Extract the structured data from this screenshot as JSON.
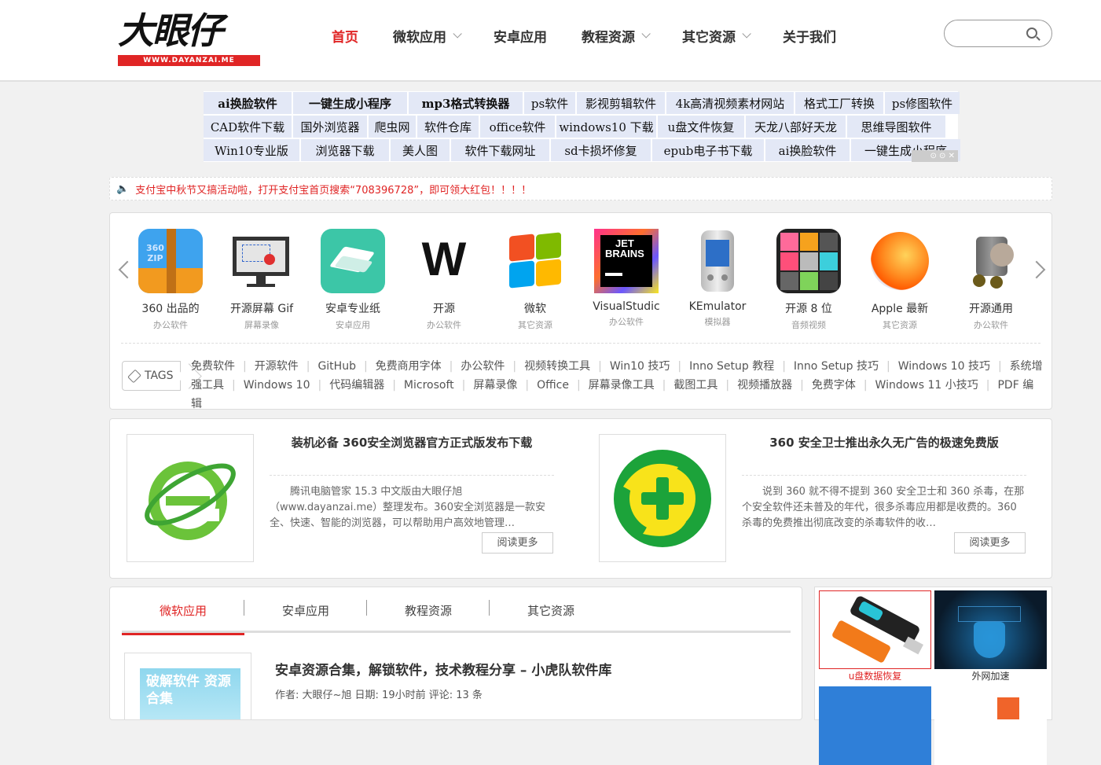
{
  "header": {
    "logo_text": "大眼仔",
    "logo_url": "WWW.DAYANZAI.ME",
    "nav": [
      {
        "label": "首页",
        "active": true,
        "dropdown": false
      },
      {
        "label": "微软应用",
        "active": false,
        "dropdown": true
      },
      {
        "label": "安卓应用",
        "active": false,
        "dropdown": false
      },
      {
        "label": "教程资源",
        "active": false,
        "dropdown": true
      },
      {
        "label": "其它资源",
        "active": false,
        "dropdown": true
      },
      {
        "label": "关于我们",
        "active": false,
        "dropdown": false
      }
    ],
    "search_placeholder": ""
  },
  "ad_links": {
    "row1": [
      "ai换脸软件",
      "一键生成小程序",
      "mp3格式转换器",
      "ps软件",
      "影视剪辑软件",
      "4k高清视频素材网站",
      "格式工厂转换",
      "ps修图软件"
    ],
    "row2": [
      "CAD软件下载",
      "国外浏览器",
      "爬虫网",
      "软件仓库",
      "office软件",
      "windows10 下载",
      "u盘文件恢复",
      "天龙八部好天龙",
      "思维导图软件"
    ],
    "row3": [
      "Win10专业版",
      "浏览器下载",
      "美人图",
      "软件下载网址",
      "sd卡损坏修复",
      "epub电子书下载",
      "ai换脸软件",
      "一键生成小程序"
    ],
    "close_label": "⊙ ⊙ ✕"
  },
  "notice": {
    "text": "支付宝中秋节又搞活动啦，打开支付宝首页搜索“708396728”，即可领大红包！！！！"
  },
  "carousel": {
    "apps": [
      {
        "title": "360 出品的",
        "category": "办公软件",
        "icon": "360zip-icon"
      },
      {
        "title": "开源屏幕 Gif",
        "category": "屏幕录像",
        "icon": "screen-gif-icon"
      },
      {
        "title": "安卓专业纸",
        "category": "安卓应用",
        "icon": "paper-icon"
      },
      {
        "title": "开源",
        "category": "办公软件",
        "icon": "w-letter-icon"
      },
      {
        "title": "微软",
        "category": "其它资源",
        "icon": "windows-icon"
      },
      {
        "title": "VisualStudic",
        "category": "办公软件",
        "icon": "jetbrains-icon"
      },
      {
        "title": "KEmulator",
        "category": "模拟器",
        "icon": "pda-icon"
      },
      {
        "title": "开源 8 位",
        "category": "音频视频",
        "icon": "pixel-grid-icon"
      },
      {
        "title": "Apple 最新",
        "category": "其它资源",
        "icon": "macos-icon"
      },
      {
        "title": "开源通用",
        "category": "办公软件",
        "icon": "squirrel-icon"
      }
    ]
  },
  "tags": {
    "label": "TAGS",
    "items": [
      "免费软件",
      "开源软件",
      "GitHub",
      "免费商用字体",
      "办公软件",
      "视频转换工具",
      "Win10 技巧",
      "Inno Setup 教程",
      "Inno Setup 技巧",
      "Windows 10 技巧",
      "系统增强工具",
      "Windows 10",
      "代码编辑器",
      "Microsoft",
      "屏幕录像",
      "Office",
      "屏幕录像工具",
      "截图工具",
      "视频播放器",
      "免费字体",
      "Windows 11 小技巧",
      "PDF 编辑"
    ]
  },
  "featured": [
    {
      "title": "装机必备 360安全浏览器官方正式版发布下载",
      "desc": "腾讯电脑管家 15.3 中文版由大眼仔旭（www.dayanzai.me）整理发布。360安全浏览器是一款安全、快速、智能的浏览器，可以帮助用户高效地管理…",
      "more": "阅读更多"
    },
    {
      "title": "360 安全卫士推出永久无广告的极速免费版",
      "desc": "说到 360 就不得不提到 360 安全卫士和 360 杀毒，在那个安全软件还未普及的年代，很多杀毒应用都是收费的。360 杀毒的免费推出彻底改变的杀毒软件的收…",
      "more": "阅读更多"
    }
  ],
  "posts": {
    "tabs": [
      "微软应用",
      "安卓应用",
      "教程资源",
      "其它资源"
    ],
    "items": [
      {
        "thumb_text": "破解软件 资源合集",
        "title": "安卓资源合集，解锁软件，技术教程分享 – 小虎队软件库",
        "meta": "作者: 大眼仔~旭 日期: 19小时前 评论: 13 条"
      }
    ]
  },
  "sidebar": {
    "items": [
      {
        "caption": "u盘数据恢复",
        "color": "#e02525"
      },
      {
        "caption": "外网加速",
        "color": "#333"
      }
    ]
  },
  "colors": {
    "accent": "#e02525",
    "ad_cell": "#e3e8f6"
  }
}
